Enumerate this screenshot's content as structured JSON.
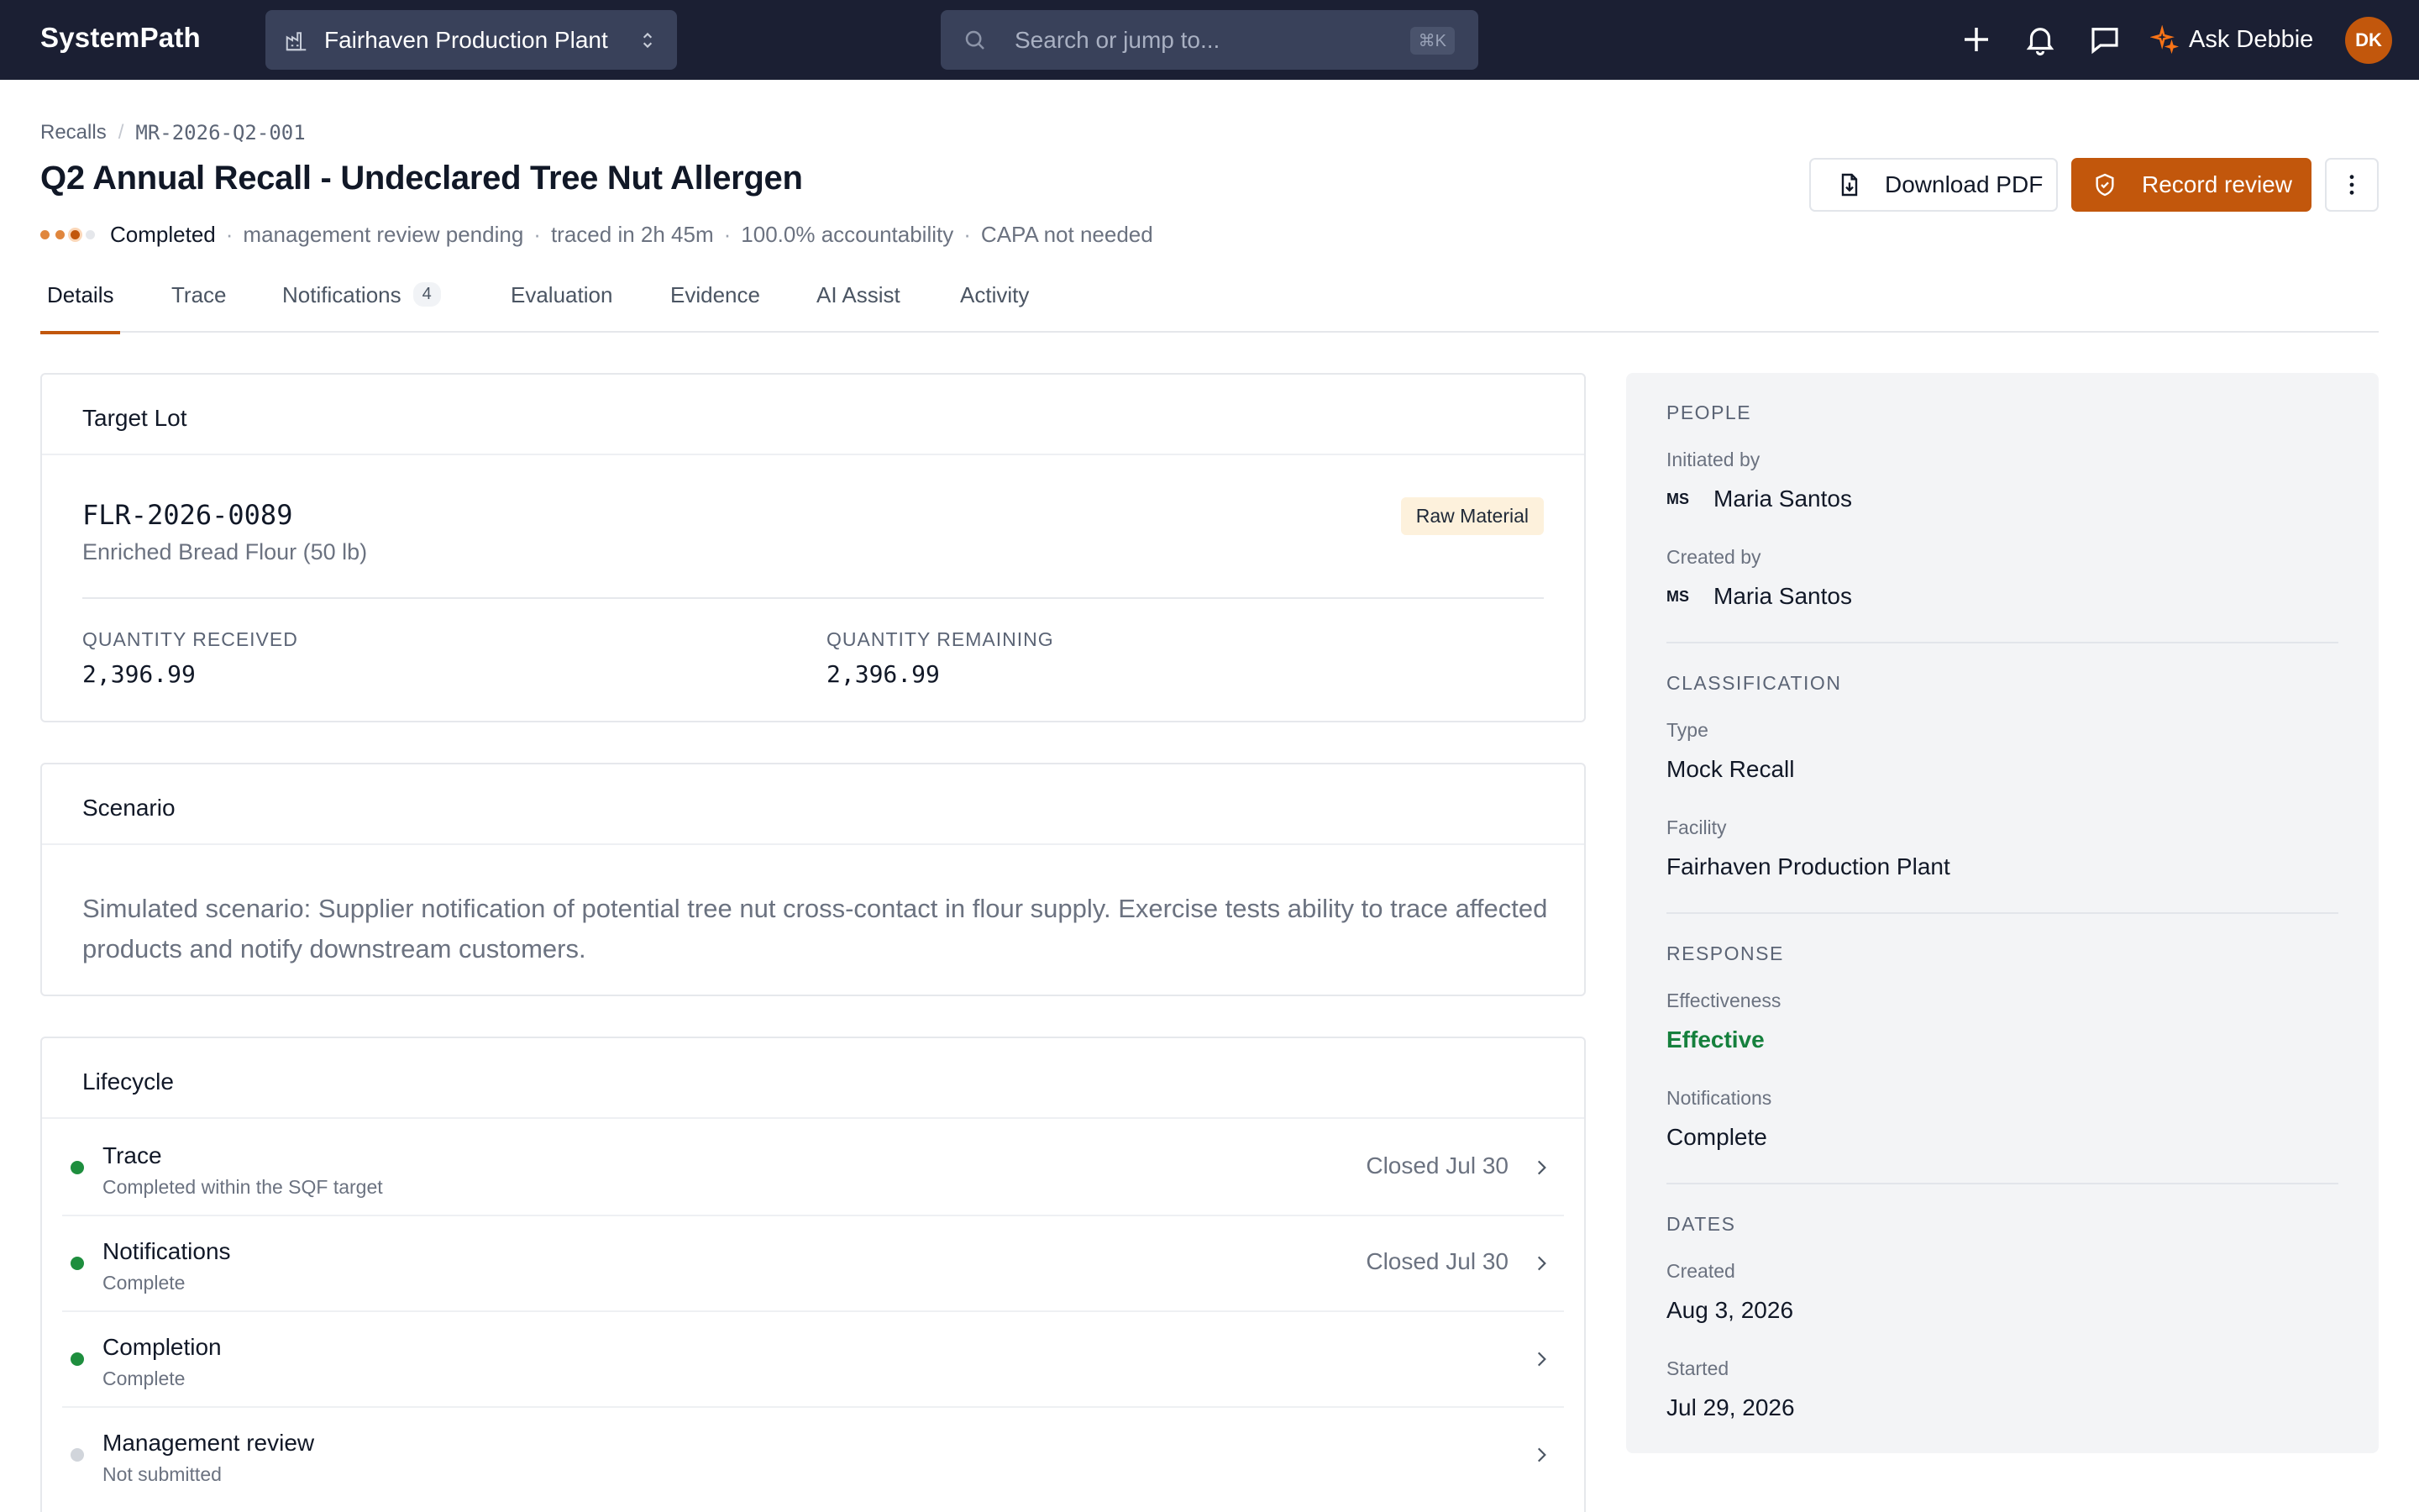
{
  "nav": {
    "brand": "SystemPath",
    "facility": "Fairhaven Production Plant",
    "search_placeholder": "Search or jump to...",
    "search_shortcut": "⌘K",
    "ask_label": "Ask Debbie",
    "avatar_initials": "DK",
    "icons": [
      "plus-icon",
      "bell-icon",
      "chat-icon",
      "sparkle-icon"
    ]
  },
  "header": {
    "breadcrumb": [
      "Recalls",
      "MR-2026-Q2-001"
    ],
    "title": "Q2 Annual Recall - Undeclared Tree Nut Allergen",
    "status": "Completed",
    "meta": [
      "management review pending",
      "traced in 2h 45m",
      "100.0% accountability",
      "CAPA not needed"
    ],
    "download_label": "Download PDF",
    "record_label": "Record review"
  },
  "tabs": [
    {
      "label": "Details",
      "active": true
    },
    {
      "label": "Trace"
    },
    {
      "label": "Notifications",
      "count": "4"
    },
    {
      "label": "Evaluation"
    },
    {
      "label": "Evidence"
    },
    {
      "label": "AI Assist"
    },
    {
      "label": "Activity"
    }
  ],
  "target_lot": {
    "title": "Target Lot",
    "lot_id": "FLR-2026-0089",
    "product": "Enriched Bread Flour (50 lb)",
    "category": "Raw Material",
    "qty_received_label": "QUANTITY RECEIVED",
    "qty_received": "2,396.99",
    "qty_remaining_label": "QUANTITY REMAINING",
    "qty_remaining": "2,396.99"
  },
  "scenario": {
    "title": "Scenario",
    "text": "Simulated scenario: Supplier notification of potential tree nut cross-contact in flour supply. Exercise tests ability to trace affected products and notify downstream customers."
  },
  "lifecycle": {
    "title": "Lifecycle",
    "steps": [
      {
        "name": "Trace",
        "sub": "Completed within the SQF target",
        "date": "Closed Jul 30",
        "state": "done"
      },
      {
        "name": "Notifications",
        "sub": "Complete",
        "date": "Closed Jul 30",
        "state": "done"
      },
      {
        "name": "Completion",
        "sub": "Complete",
        "date": "",
        "state": "done"
      },
      {
        "name": "Management review",
        "sub": "Not submitted",
        "date": "",
        "state": "pending"
      }
    ]
  },
  "side": {
    "people": {
      "label": "PEOPLE",
      "initiated_label": "Initiated by",
      "initiated_initials": "MS",
      "initiated_name": "Maria Santos",
      "created_label": "Created by",
      "created_initials": "MS",
      "created_name": "Maria Santos"
    },
    "classification": {
      "label": "CLASSIFICATION",
      "type_label": "Type",
      "type_value": "Mock Recall",
      "facility_label": "Facility",
      "facility_value": "Fairhaven Production Plant"
    },
    "response": {
      "label": "RESPONSE",
      "effectiveness_label": "Effectiveness",
      "effectiveness_value": "Effective",
      "notifications_label": "Notifications",
      "notifications_value": "Complete"
    },
    "dates": {
      "label": "DATES",
      "created_label": "Created",
      "created_value": "Aug 3, 2026",
      "started_label": "Started",
      "started_value": "Jul 29, 2026"
    }
  },
  "colors": {
    "accent": "#c2570c",
    "nav_bg": "#1b1f33",
    "success": "#15803d",
    "success_dot": "#1e8e3e",
    "pending_dot": "#d1d5db",
    "chip_bg": "#fdf1dc"
  }
}
